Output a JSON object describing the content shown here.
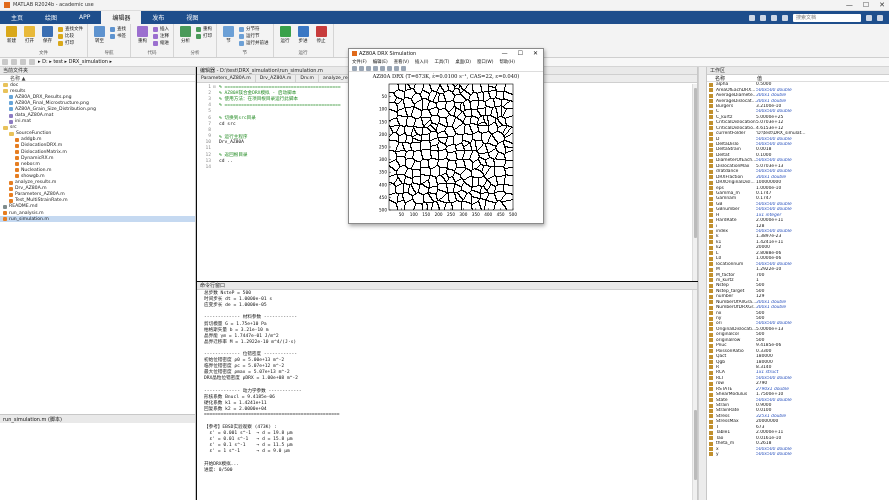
{
  "window": {
    "title": "MATLAB R2024b - academic use",
    "controls": [
      "—",
      "☐",
      "✕"
    ]
  },
  "ribbon_tabs": [
    {
      "label": "主页"
    },
    {
      "label": "绘图"
    },
    {
      "label": "APP"
    },
    {
      "label": "编辑器",
      "active": true
    },
    {
      "label": "发布"
    },
    {
      "label": "视图"
    }
  ],
  "search": {
    "placeholder": "搜索文档"
  },
  "ribbon_groups": [
    {
      "label": "文件",
      "buttons": [
        "新建",
        "打开",
        "保存"
      ],
      "small": [
        "查找文件",
        "比较",
        "打印"
      ],
      "colors": [
        "#d9a81a",
        "#e8b93a",
        "#3b6fb3"
      ]
    },
    {
      "label": "导航",
      "buttons": [
        "转至"
      ],
      "small": [
        "查找",
        "书签"
      ],
      "colors": [
        "#5e93cf"
      ]
    },
    {
      "label": "代码",
      "buttons": [
        "重构"
      ],
      "small": [
        "插入",
        "注释",
        "缩进"
      ],
      "colors": [
        "#9b6fcf"
      ]
    },
    {
      "label": "分析",
      "buttons": [
        "分析"
      ],
      "small": [
        "重构",
        "打印"
      ],
      "colors": [
        "#4a9a5a"
      ]
    },
    {
      "label": "节",
      "buttons": [
        "节"
      ],
      "small": [
        "分节符",
        "运行节",
        "运行并前进"
      ],
      "colors": [
        "#6ca0d6"
      ]
    },
    {
      "label": "运行",
      "buttons": [
        "运行",
        "步进",
        "停止"
      ],
      "small": [],
      "colors": [
        "#3aa14a",
        "#3b78c4",
        "#c73c3c"
      ]
    }
  ],
  "address": {
    "path": "▸ D: ▸ test ▸ DRX_simulation ▸"
  },
  "folder_panel": {
    "title": "当前文件夹",
    "column": "名称 ▲",
    "items": [
      {
        "name": "doc",
        "type": "folder",
        "indent": 0
      },
      {
        "name": "results",
        "type": "folder",
        "indent": 0
      },
      {
        "name": "AZ80A_DRX_Results.png",
        "type": "png",
        "indent": 1
      },
      {
        "name": "AZ80A_Final_Microstructure.png",
        "type": "png",
        "indent": 1
      },
      {
        "name": "AZ80A_Grain_Size_Distribution.png",
        "type": "png",
        "indent": 1
      },
      {
        "name": "data_AZ80A.mat",
        "type": "mat",
        "indent": 1
      },
      {
        "name": "ini.mat",
        "type": "mat",
        "indent": 1
      },
      {
        "name": "src",
        "type": "folder",
        "indent": 0
      },
      {
        "name": "SourceFunction",
        "type": "folder",
        "indent": 1
      },
      {
        "name": "addgb.m",
        "type": "m",
        "indent": 2
      },
      {
        "name": "DislocationDRX.m",
        "type": "m",
        "indent": 2
      },
      {
        "name": "DislocationMatrix.m",
        "type": "m",
        "indent": 2
      },
      {
        "name": "DynamicRX.m",
        "type": "m",
        "indent": 2
      },
      {
        "name": "nebor.m",
        "type": "m",
        "indent": 2
      },
      {
        "name": "Nucleation.m",
        "type": "m",
        "indent": 2
      },
      {
        "name": "showgb.m",
        "type": "m",
        "indent": 2
      },
      {
        "name": "analyze_results.m",
        "type": "m",
        "indent": 1
      },
      {
        "name": "Drv_AZ80A.m",
        "type": "m",
        "indent": 1
      },
      {
        "name": "Parameters_AZ80A.m",
        "type": "m",
        "indent": 1
      },
      {
        "name": "Test_MultiStrainRate.m",
        "type": "m",
        "indent": 1
      },
      {
        "name": "README.md",
        "type": "md",
        "indent": 0
      },
      {
        "name": "run_analysis.m",
        "type": "m",
        "indent": 0
      },
      {
        "name": "run_simulation.m",
        "type": "m",
        "indent": 0,
        "selected": true
      }
    ]
  },
  "details_panel": {
    "title": "run_simulation.m (脚本)"
  },
  "editor": {
    "title": "编辑器 - D:\\test\\DRX_simulation\\run_simulation.m",
    "tabs": [
      "Parameters_AZ80A.m",
      "Drv_AZ80A.m",
      "Drv.m",
      "analyze_results.m",
      "run_simulation.m"
    ],
    "active_tab": 4,
    "lines": [
      {
        "n": "1",
        "g": "⊟",
        "t": "% ==========================================",
        "c": true
      },
      {
        "n": "2",
        "g": "",
        "t": "% AZ80A镁合金DRX模拟 - 启动脚本",
        "c": true
      },
      {
        "n": "3",
        "g": "",
        "t": "% 使用方法：在项目根目录运行此脚本",
        "c": true
      },
      {
        "n": "4",
        "g": "",
        "t": "% ==========================================",
        "c": true
      },
      {
        "n": "5",
        "g": "",
        "t": "",
        "c": false
      },
      {
        "n": "6",
        "g": "",
        "t": "% 切换到src目录",
        "c": true
      },
      {
        "n": "7",
        "g": "",
        "t": "cd src",
        "c": false
      },
      {
        "n": "8",
        "g": "",
        "t": "",
        "c": false
      },
      {
        "n": "9",
        "g": "",
        "t": "% 运行主程序",
        "c": true
      },
      {
        "n": "10",
        "g": "",
        "t": "Drv_AZ80A",
        "c": false
      },
      {
        "n": "11",
        "g": "",
        "t": "",
        "c": false
      },
      {
        "n": "12",
        "g": "",
        "t": "% 返回根目录",
        "c": true
      },
      {
        "n": "13",
        "g": "",
        "t": "cd ..",
        "c": false
      },
      {
        "n": "14",
        "g": "",
        "t": "",
        "c": false
      }
    ]
  },
  "command_window": {
    "title": "命令行窗口",
    "lines": [
      "总步数 NsteP = 500",
      "时间步长 dt = 1.0000e-01 s",
      "应变步长 de = 1.0000e-05",
      "",
      "------------- 材料参数 ------------",
      "剪切模量 G = 1.75e+10 Pa",
      "柏格斯矢量 b = 3.21e-10 m",
      "晶界能 γm = 1.7447e-01 J/m^2",
      "晶界迁移率 M = 1.2922e-10 m^4/(J·s)",
      "",
      "------------- 位错密度 ------------",
      "初始位错密度 ρ0 = 5.00e+13 m^-2",
      "临界位错密度 ρc = 5.07e+12 m^-2",
      "最大位错密度 ρmax = 5.07e+13 m^-2",
      "DRX晶粒位错密度 ρDRX = 1.00e+08 m^-2",
      "",
      "------------- 动力学参数 ------------",
      "形核系数 Bnucl = 9.4185e-06",
      "硬化系数 k1 = 1.4241e+11",
      "回复系数 k2 = 2.0000e+04",
      "=================================================",
      "",
      "【参考】EBSD实验观察 (473K) :",
      "  ε' = 0.001 s^-1  → d = 19.8 μm",
      "  ε' = 0.01 s^-1   → d = 15.8 μm",
      "  ε' = 0.1 s^-1    → d = 11.5 μm",
      "  ε' = 1 s^-1      → d = 9.0 μm",
      "",
      "开始DRX模拟...",
      "进度: 0/500"
    ]
  },
  "workspace": {
    "title": "工作区",
    "headers": [
      "名称",
      "值"
    ],
    "vars": [
      {
        "n": "alpha",
        "v": "0.5000",
        "it": false
      },
      {
        "n": "AreaOfEachDRX...",
        "v": "500x500 double",
        "it": true
      },
      {
        "n": "AverageDiamete...",
        "v": "300x1 double",
        "it": true
      },
      {
        "n": "AverageDislocat...",
        "v": "300x1 double",
        "it": true
      },
      {
        "n": "Burgers",
        "v": "3.2100e-10",
        "it": false
      },
      {
        "n": "C",
        "v": "500x500 double",
        "it": true
      },
      {
        "n": "C_kurtz",
        "v": "5.0000e+25",
        "it": false
      },
      {
        "n": "CriticalDislocation",
        "v": "5.0703e+12",
        "it": false
      },
      {
        "n": "CriticalDislocatio...",
        "v": "4.6153e+12",
        "it": false
      },
      {
        "n": "currentFolder",
        "v": "'D:\\test\\DRX_simulat...",
        "it": false
      },
      {
        "n": "D",
        "v": "500x500 double",
        "it": true
      },
      {
        "n": "DeltaDislo",
        "v": "500x500 double",
        "it": true
      },
      {
        "n": "DeltaStrain",
        "v": "0.0018",
        "it": false
      },
      {
        "n": "Deltat",
        "v": "0.1000",
        "it": false
      },
      {
        "n": "DiameterOfEach...",
        "v": "500x500 double",
        "it": true
      },
      {
        "n": "DislocationMax",
        "v": "5.0703e+13",
        "it": false
      },
      {
        "n": "dratdance",
        "v": "500x500 double",
        "it": true
      },
      {
        "n": "DRXFraction",
        "v": "300x1 double",
        "it": true
      },
      {
        "n": "DRXOriginalDisl...",
        "v": "100000000",
        "it": false
      },
      {
        "n": "eps",
        "v": "1.0000e-10",
        "it": false
      },
      {
        "n": "Gamma_m",
        "v": "0.1747",
        "it": false
      },
      {
        "n": "Gamnam",
        "v": "0.1747",
        "it": false
      },
      {
        "n": "GB",
        "v": "500x500 double",
        "it": true
      },
      {
        "n": "GBnumber",
        "v": "500x500 double",
        "it": true
      },
      {
        "n": "H",
        "v": "1x1 integer",
        "it": true
      },
      {
        "n": "HardRate",
        "v": "2.0000e+11",
        "it": false
      },
      {
        "n": "i",
        "v": "128",
        "it": false
      },
      {
        "n": "index",
        "v": "500x500 double",
        "it": true
      },
      {
        "n": "k",
        "v": "1.3897e-23",
        "it": false
      },
      {
        "n": "k1",
        "v": "1.4241e+11",
        "it": false
      },
      {
        "n": "k2",
        "v": "20000",
        "it": false
      },
      {
        "n": "L",
        "v": "2.8088e-06",
        "it": false
      },
      {
        "n": "L0",
        "v": "1.0000e-06",
        "it": false
      },
      {
        "n": "locationnum",
        "v": "500x500 double",
        "it": true
      },
      {
        "n": "M",
        "v": "1.2922e-10",
        "it": false
      },
      {
        "n": "M_factor",
        "v": "700",
        "it": false
      },
      {
        "n": "m_kurtz",
        "v": "1",
        "it": false
      },
      {
        "n": "Nstep",
        "v": "500",
        "it": false
      },
      {
        "n": "Nstep_target",
        "v": "500",
        "it": false
      },
      {
        "n": "number",
        "v": "129",
        "it": false
      },
      {
        "n": "NumberOfAllGra...",
        "v": "300x1 double",
        "it": true
      },
      {
        "n": "NumberOfDRXGr...",
        "v": "300x1 double",
        "it": true
      },
      {
        "n": "nx",
        "v": "500",
        "it": false
      },
      {
        "n": "ny",
        "v": "500",
        "it": false
      },
      {
        "n": "ori",
        "v": "500x500 double",
        "it": true
      },
      {
        "n": "OriginalDislocati...",
        "v": "5.0000e+13",
        "it": false
      },
      {
        "n": "originalcol",
        "v": "500",
        "it": false
      },
      {
        "n": "originalrow",
        "v": "500",
        "it": false
      },
      {
        "n": "Pnuc",
        "v": "9.4185e-06",
        "it": false
      },
      {
        "n": "PoissonRatio",
        "v": "0.3300",
        "it": false
      },
      {
        "n": "Qact",
        "v": "180000",
        "it": false
      },
      {
        "n": "Qgb",
        "v": "180000",
        "it": false
      },
      {
        "n": "R",
        "v": "8.3140",
        "it": false
      },
      {
        "n": "RCA",
        "v": "1x1 struct",
        "it": true
      },
      {
        "n": "RLT",
        "v": "500x500 double",
        "it": true
      },
      {
        "n": "row",
        "v": "2790",
        "it": false
      },
      {
        "n": "RSTATE",
        "v": "2790x1 double",
        "it": true
      },
      {
        "n": "ShearModulus",
        "v": "1.7500e+10",
        "it": false
      },
      {
        "n": "State",
        "v": "500x500 double",
        "it": true
      },
      {
        "n": "Strain",
        "v": "0.9000",
        "it": false
      },
      {
        "n": "StrainRate",
        "v": "0.0100",
        "it": false
      },
      {
        "n": "Stress",
        "v": "325x1 double",
        "it": true
      },
      {
        "n": "StressMax",
        "v": "20000000",
        "it": false
      },
      {
        "n": "T",
        "v": "673",
        "it": false
      },
      {
        "n": "Table1",
        "v": "2.0000e+11",
        "it": false
      },
      {
        "n": "Tao",
        "v": "0.0161e-10",
        "it": false
      },
      {
        "n": "theta_m",
        "v": "0.2618",
        "it": false
      },
      {
        "n": "x",
        "v": "500x500 double",
        "it": true
      },
      {
        "n": "y",
        "v": "500x500 double",
        "it": true
      }
    ]
  },
  "figure": {
    "title": "AZ80A DRX Simulation",
    "menu": [
      "文件(F)",
      "编辑(E)",
      "查看(V)",
      "插入(I)",
      "工具(T)",
      "桌面(D)",
      "窗口(W)",
      "帮助(H)"
    ],
    "plot_title": "AZ80A DRX (T=673K, ε̇=0.0100 s⁻¹, CAS=22, ε=0.040)",
    "x_ticks": [
      "50",
      "100",
      "150",
      "200",
      "250",
      "300",
      "350",
      "400",
      "450",
      "500"
    ],
    "y_ticks": [
      "50",
      "100",
      "150",
      "200",
      "250",
      "300",
      "350",
      "400",
      "450",
      "500"
    ]
  }
}
